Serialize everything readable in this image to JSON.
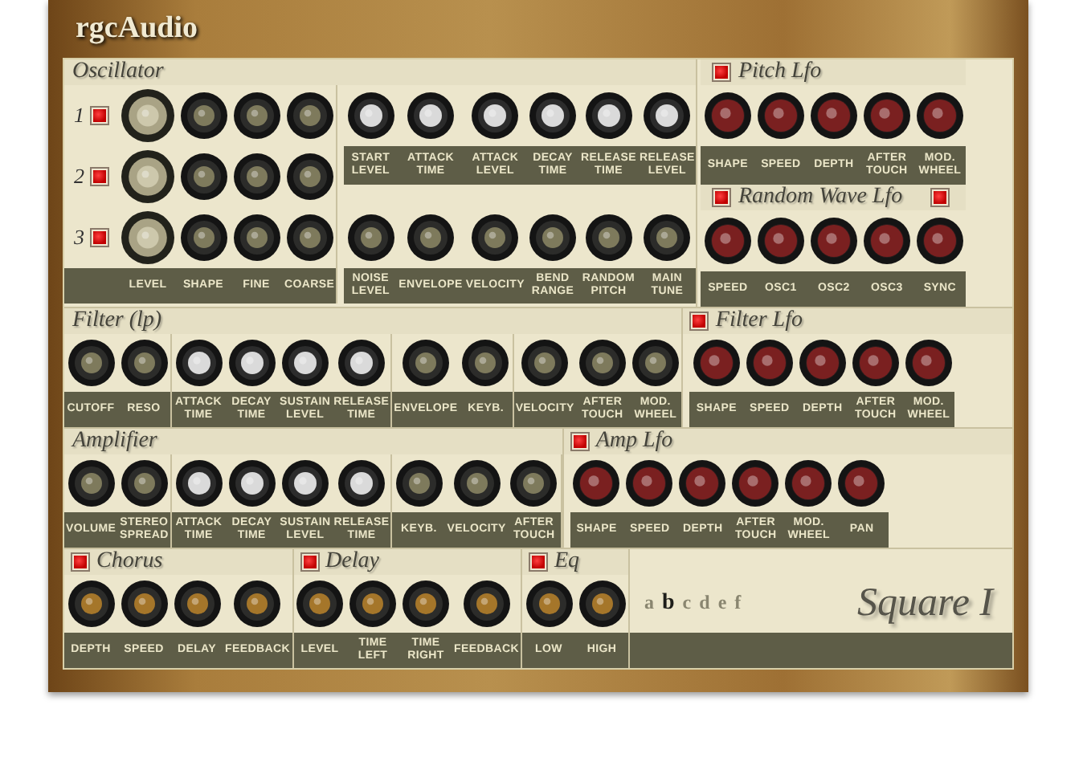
{
  "brand": "rgcAudio",
  "oscillator": {
    "title": "Oscillator",
    "voices": [
      {
        "number": "1",
        "on": true
      },
      {
        "number": "2",
        "on": true
      },
      {
        "number": "3",
        "on": true
      }
    ],
    "labels": [
      "LEVEL",
      "SHAPE",
      "FINE",
      "COARSE"
    ],
    "envelope": [
      "START LEVEL",
      "ATTACK TIME",
      "ATTACK LEVEL",
      "DECAY TIME",
      "RELEASE TIME",
      "RELEASE LEVEL"
    ],
    "modulation": [
      "NOISE LEVEL",
      "ENVELOPE",
      "VELOCITY",
      "BEND RANGE",
      "RANDOM PITCH",
      "MAIN TUNE"
    ]
  },
  "pitch_lfo": {
    "title": "Pitch Lfo",
    "on": true,
    "knobs": [
      "SHAPE",
      "SPEED",
      "DEPTH",
      "AFTER TOUCH",
      "MOD. WHEEL"
    ]
  },
  "random_wave_lfo": {
    "title": "Random Wave Lfo",
    "on": true,
    "sync_on": true,
    "knobs": [
      "SPEED",
      "OSC1",
      "OSC2",
      "OSC3",
      "SYNC"
    ]
  },
  "filter": {
    "title": "Filter (lp)",
    "groups": [
      {
        "kind": "dark",
        "knobs": [
          "CUTOFF",
          "RESO"
        ]
      },
      {
        "kind": "silver",
        "knobs": [
          "ATTACK TIME",
          "DECAY TIME",
          "SUSTAIN LEVEL",
          "RELEASE TIME"
        ]
      },
      {
        "kind": "dark",
        "knobs": [
          "ENVELOPE",
          "KEYB."
        ]
      },
      {
        "kind": "dark",
        "knobs": [
          "VELOCITY",
          "AFTER TOUCH",
          "MOD. WHEEL"
        ]
      }
    ]
  },
  "filter_lfo": {
    "title": "Filter Lfo",
    "on": true,
    "knobs": [
      "SHAPE",
      "SPEED",
      "DEPTH",
      "AFTER TOUCH",
      "MOD. WHEEL"
    ]
  },
  "amplifier": {
    "title": "Amplifier",
    "groups": [
      {
        "kind": "dark",
        "knobs": [
          "VOLUME",
          "STEREO SPREAD"
        ]
      },
      {
        "kind": "silver",
        "knobs": [
          "ATTACK TIME",
          "DECAY TIME",
          "SUSTAIN LEVEL",
          "RELEASE TIME"
        ]
      },
      {
        "kind": "dark",
        "knobs": [
          "KEYB.",
          "VELOCITY",
          "AFTER TOUCH"
        ]
      }
    ]
  },
  "amp_lfo": {
    "title": "Amp Lfo",
    "on": true,
    "knobs": [
      "SHAPE",
      "SPEED",
      "DEPTH",
      "AFTER TOUCH",
      "MOD. WHEEL",
      "PAN"
    ]
  },
  "effects": [
    {
      "title": "Chorus",
      "on": true,
      "knobs": [
        "DEPTH",
        "SPEED",
        "DELAY",
        "FEEDBACK"
      ]
    },
    {
      "title": "Delay",
      "on": true,
      "knobs": [
        "LEVEL",
        "TIME LEFT",
        "TIME RIGHT",
        "FEEDBACK"
      ]
    },
    {
      "title": "Eq",
      "on": true,
      "knobs": [
        "LOW",
        "HIGH"
      ]
    }
  ],
  "presets": [
    {
      "label": "a",
      "selected": false
    },
    {
      "label": "b",
      "selected": true
    },
    {
      "label": "c",
      "selected": false
    },
    {
      "label": "d",
      "selected": false
    },
    {
      "label": "e",
      "selected": false
    },
    {
      "label": "f",
      "selected": false
    }
  ],
  "preset_name": "Square I"
}
